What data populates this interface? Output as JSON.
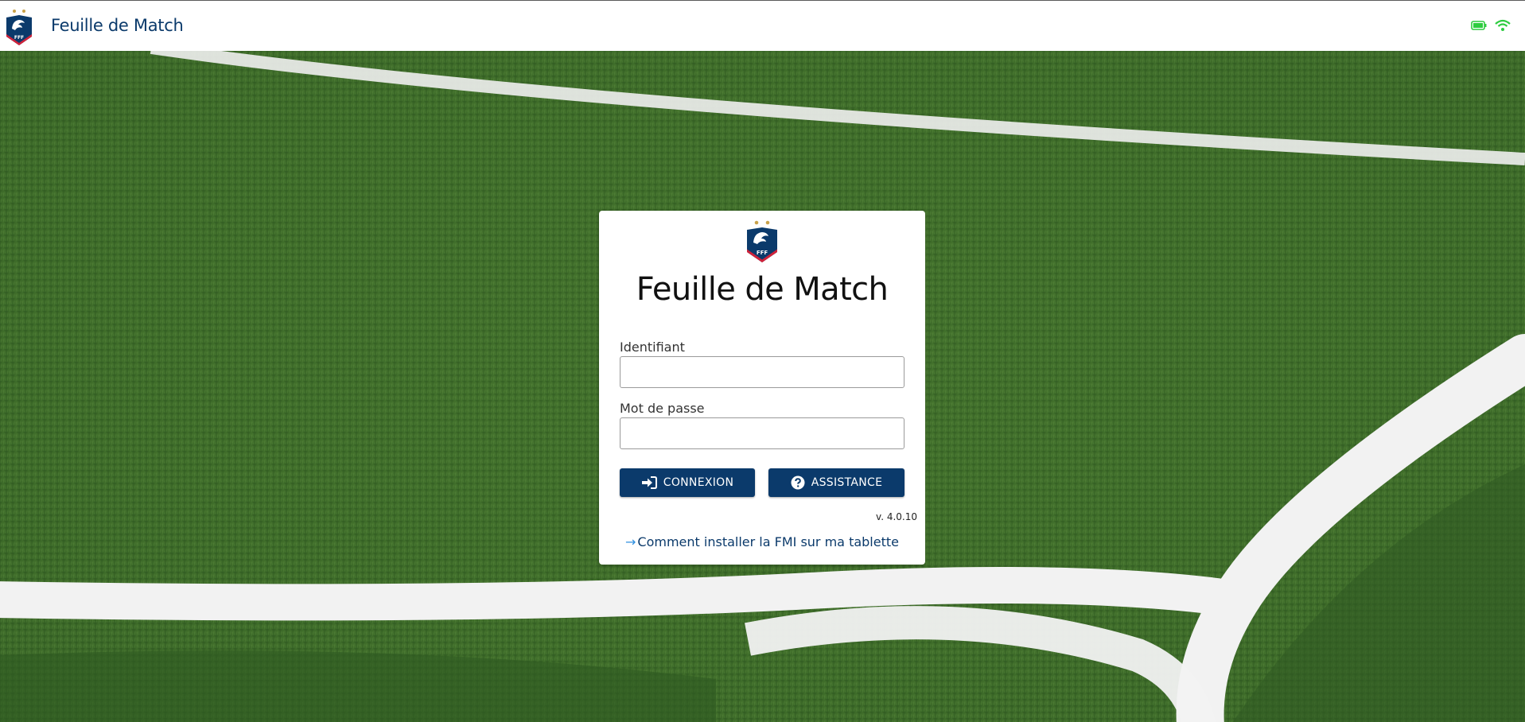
{
  "header": {
    "app_title": "Feuille de Match",
    "logo_text": "FFF"
  },
  "status": {
    "battery_icon": "battery-icon",
    "wifi_icon": "wifi-icon",
    "accent_color": "#2ecc40"
  },
  "login": {
    "title": "Feuille de Match",
    "logo_text": "FFF",
    "identifiant_label": "Identifiant",
    "identifiant_value": "",
    "password_label": "Mot de passe",
    "password_value": "",
    "connexion_label": "CONNEXION",
    "assistance_label": "ASSISTANCE",
    "version": "v. 4.0.10",
    "install_link": "Comment installer la FMI sur ma tablette"
  },
  "colors": {
    "brand_blue": "#0b3a6b",
    "grass": "#3f6b2a",
    "line_white": "#f2f2f2",
    "link_arrow": "#2f8fe0"
  }
}
